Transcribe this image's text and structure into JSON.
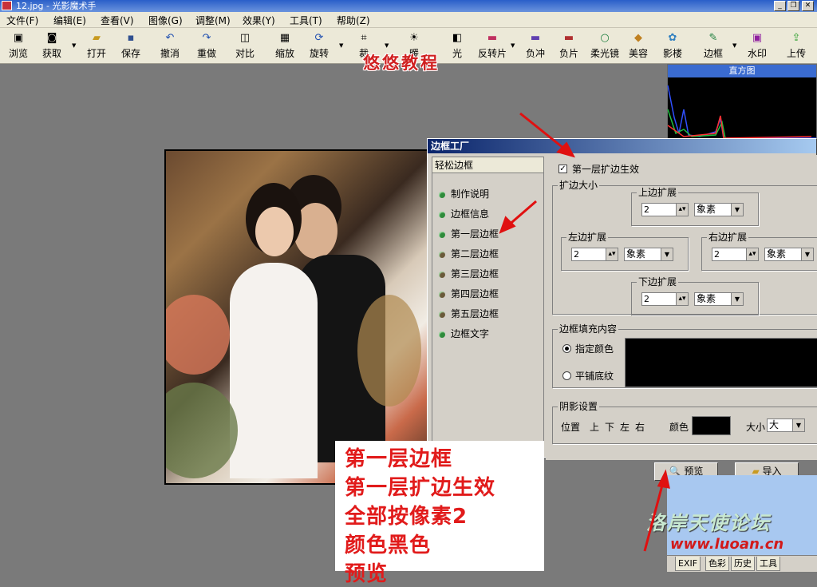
{
  "window": {
    "title": "12.jpg - 光影魔术手"
  },
  "menu": [
    "文件(F)",
    "编辑(E)",
    "查看(V)",
    "图像(G)",
    "调整(M)",
    "效果(Y)",
    "工具(T)",
    "帮助(Z)"
  ],
  "toolbar": [
    {
      "label": "浏览",
      "icon": "browse-icon"
    },
    {
      "label": "获取",
      "icon": "camera-icon"
    },
    {
      "label": "打开",
      "icon": "folder-icon"
    },
    {
      "label": "保存",
      "icon": "save-icon"
    },
    {
      "label": "撤消",
      "icon": "undo-icon"
    },
    {
      "label": "重做",
      "icon": "redo-icon"
    },
    {
      "label": "对比",
      "icon": "compare-icon"
    },
    {
      "label": "缩放",
      "icon": "zoom-icon"
    },
    {
      "label": "旋转",
      "icon": "rotate-icon"
    },
    {
      "label": "裁",
      "icon": "crop-icon"
    },
    {
      "label": "暖",
      "icon": "bulb-icon"
    },
    {
      "label": "光",
      "icon": "light-icon"
    },
    {
      "label": "反转片",
      "icon": "reversal-icon"
    },
    {
      "label": "负冲",
      "icon": "negative-cross-icon"
    },
    {
      "label": "负片",
      "icon": "negative-icon"
    },
    {
      "label": "柔光镜",
      "icon": "softlight-icon"
    },
    {
      "label": "美容",
      "icon": "beauty-icon"
    },
    {
      "label": "影楼",
      "icon": "studio-icon"
    },
    {
      "label": "边框",
      "icon": "frame-icon"
    },
    {
      "label": "水印",
      "icon": "watermark-icon"
    },
    {
      "label": "上传",
      "icon": "upload-icon"
    }
  ],
  "overlay_title": "悠悠教程",
  "histogram": {
    "title": "直方图"
  },
  "dialog": {
    "title": "边框工厂",
    "left_header": "轻松边框",
    "left_items": [
      "制作说明",
      "边框信息",
      "第一层边框",
      "第二层边框",
      "第三层边框",
      "第四层边框",
      "第五层边框",
      "边框文字"
    ],
    "enable_label": "第一层扩边生效",
    "enable_checked": true,
    "expand_group": "扩边大小",
    "top": {
      "label": "上边扩展",
      "value": "2",
      "unit": "象素"
    },
    "left": {
      "label": "左边扩展",
      "value": "2",
      "unit": "象素"
    },
    "right": {
      "label": "右边扩展",
      "value": "2",
      "unit": "象素"
    },
    "bottom": {
      "label": "下边扩展",
      "value": "2",
      "unit": "象素"
    },
    "fill_group": "边框填充内容",
    "fill_color_label": "指定颜色",
    "fill_texture_label": "平铺底纹",
    "fill_color": "#000000",
    "shadow_group": "阴影设置",
    "shadow_pos_label": "位置",
    "shadow_positions": [
      "上",
      "下",
      "左",
      "右"
    ],
    "shadow_color_label": "颜色",
    "shadow_color": "#000000",
    "shadow_size_label": "大小",
    "shadow_size_value": "大",
    "preview_btn": "预览",
    "import_btn": "导入"
  },
  "annotation": [
    "第一层边框",
    "第一层扩边生效",
    "全部按像素2",
    "颜色黑色",
    "预览"
  ],
  "forum": {
    "name": "洛岸天使论坛",
    "url": "www.luoan.cn"
  },
  "bottom_tabs": [
    "EXIF",
    "色彩",
    "历史",
    "工具"
  ]
}
